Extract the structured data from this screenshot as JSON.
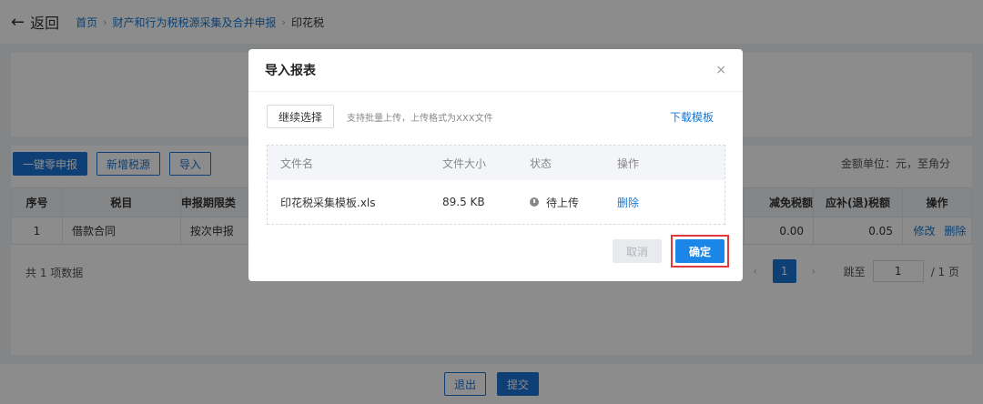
{
  "header": {
    "back_label": "返回",
    "breadcrumb": [
      "首页",
      "财产和行为税税源采集及合并申报",
      "印花税"
    ]
  },
  "toolbar": {
    "zero_declare": "一键零申报",
    "add_source": "新增税源",
    "import": "导入",
    "unit_note": "金额单位：元，至角分"
  },
  "table": {
    "headers": [
      "序号",
      "税目",
      "申报期限类",
      "减免税额",
      "应补(退)税额",
      "操作"
    ],
    "rows": [
      {
        "index": "1",
        "item": "借款合同",
        "period": "按次申报",
        "relief": "0.00",
        "payable": "0.05",
        "edit": "修改",
        "delete": "删除"
      }
    ]
  },
  "pagination": {
    "total": "共 1 项数据",
    "current": "1",
    "jump_label": "跳至",
    "jump_value": "1",
    "total_pages": "/ 1 页",
    "prev": "‹",
    "next": "›"
  },
  "footer": {
    "exit": "退出",
    "submit": "提交"
  },
  "modal": {
    "title": "导入报表",
    "close": "×",
    "continue_select": "继续选择",
    "hint": "支持批量上传，上传格式为XXX文件",
    "download_template": "下载模板",
    "columns": {
      "name": "文件名",
      "size": "文件大小",
      "status": "状态",
      "op": "操作"
    },
    "file": {
      "name": "印花税采集模板.xls",
      "size": "89.5 KB",
      "status": "待上传",
      "op": "删除"
    },
    "cancel": "取消",
    "confirm": "确定"
  },
  "colors": {
    "primary": "#1a73d6",
    "highlight": "#e0393e"
  },
  "icons": {
    "back": "arrow-left-icon",
    "close": "close-icon",
    "status": "clock-icon"
  }
}
